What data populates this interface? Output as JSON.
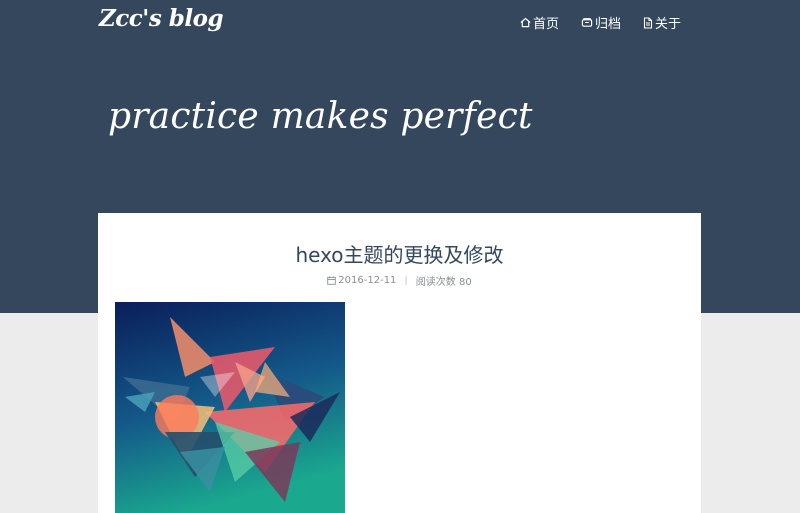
{
  "header": {
    "brand": "Zcc's blog",
    "nav": [
      {
        "label": "首页",
        "icon": "home-icon"
      },
      {
        "label": "归档",
        "icon": "archive-icon"
      },
      {
        "label": "关于",
        "icon": "document-icon"
      }
    ],
    "slogan": "practice makes perfect"
  },
  "post": {
    "title": "hexo主题的更换及修改",
    "date": "2016-12-11",
    "separator": "|",
    "views_label": "阅读次数 80",
    "cover_alt": "low-poly abstract artwork"
  },
  "colors": {
    "header_bg": "#34475c",
    "page_bg": "#ececec",
    "card_bg": "#ffffff",
    "title_color": "#34475c"
  }
}
